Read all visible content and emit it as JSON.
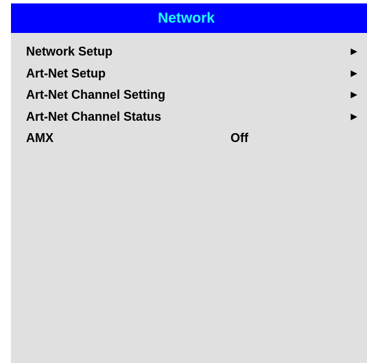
{
  "window": {
    "title": "Network"
  },
  "menu": {
    "items": [
      {
        "label": "Network Setup",
        "arrow": "►",
        "icon": "arrow-right-icon"
      },
      {
        "label": "Art-Net Setup",
        "arrow": "►",
        "icon": "arrow-right-icon"
      },
      {
        "label": "Art-Net Channel Setting",
        "arrow": "►",
        "icon": "arrow-right-icon"
      },
      {
        "label": "Art-Net Channel Status",
        "arrow": "►",
        "icon": "arrow-right-icon"
      },
      {
        "label": "AMX",
        "value": "Off"
      }
    ]
  },
  "colors": {
    "header_background": "#0000fe",
    "header_text": "#21ffff",
    "panel_background": "#e0e0e0",
    "item_text": "#000000"
  }
}
